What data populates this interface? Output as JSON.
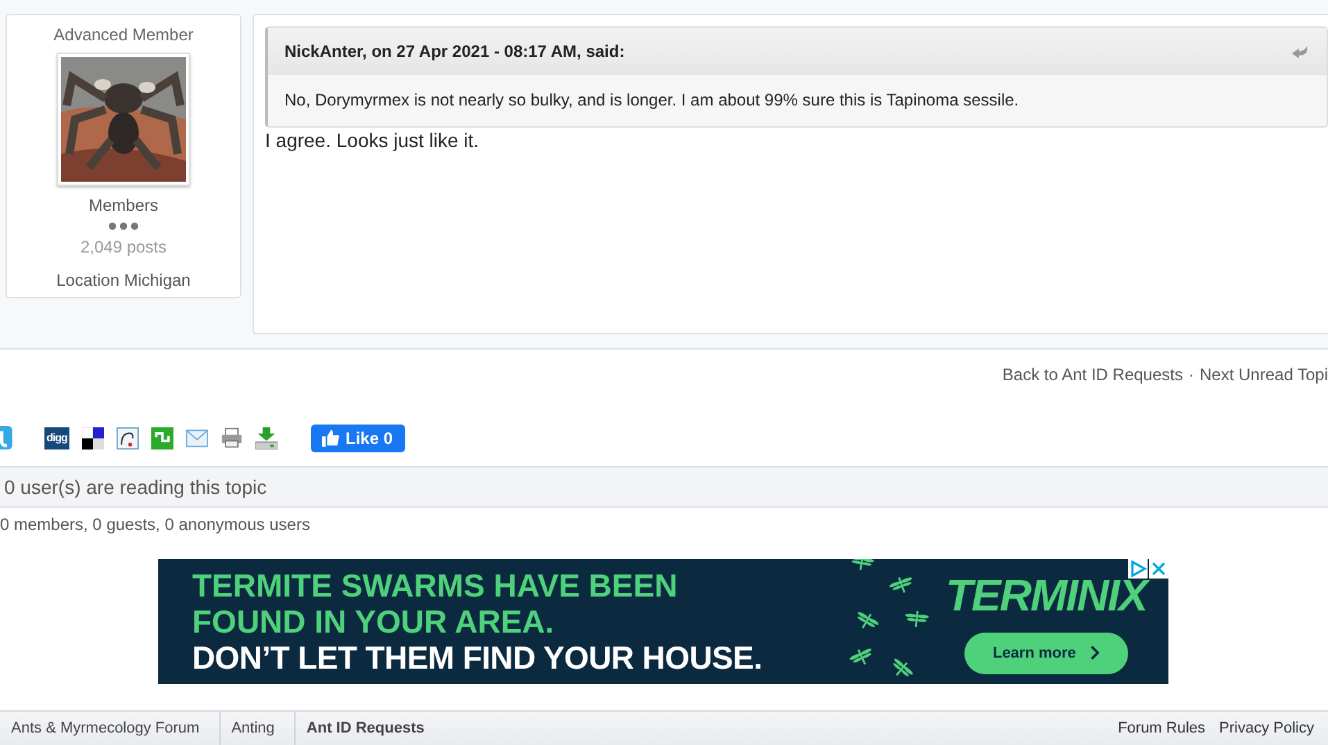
{
  "author": {
    "title": "Advanced Member",
    "group": "Members",
    "posts": "2,049 posts",
    "location_label": "Location",
    "location": "Michigan"
  },
  "post": {
    "quote": {
      "citation": "NickAnter, on 27 Apr 2021 - 08:17 AM, said:",
      "text": "No, Dorymyrmex is not nearly so bulky, and is longer. I am about 99% sure this is Tapinoma sessile."
    },
    "text": "I agree. Looks just like it."
  },
  "topic_nav": [
    {
      "label": "Back to Ant ID Requests"
    },
    {
      "label": "Next Unread Topi"
    }
  ],
  "topic_nav_separator": "·",
  "share": {
    "digg_label": "digg",
    "like": {
      "label": "Like",
      "count": "0"
    }
  },
  "readers": {
    "title": "0 user(s) are reading this topic",
    "detail": "0 members, 0 guests, 0 anonymous users"
  },
  "ad": {
    "headline": [
      "TERMITE SWARMS HAVE BEEN",
      "FOUND IN YOUR AREA."
    ],
    "tagline": "DON’T LET THEM FIND YOUR HOUSE.",
    "logo": "TERMINIX",
    "button": "Learn more"
  },
  "breadcrumb": [
    {
      "label": "Ants & Myrmecology Forum",
      "selected": false
    },
    {
      "label": "Anting",
      "selected": false
    },
    {
      "label": "Ant ID Requests",
      "selected": true
    }
  ],
  "footer_links": [
    "Forum Rules",
    "Privacy Policy"
  ]
}
